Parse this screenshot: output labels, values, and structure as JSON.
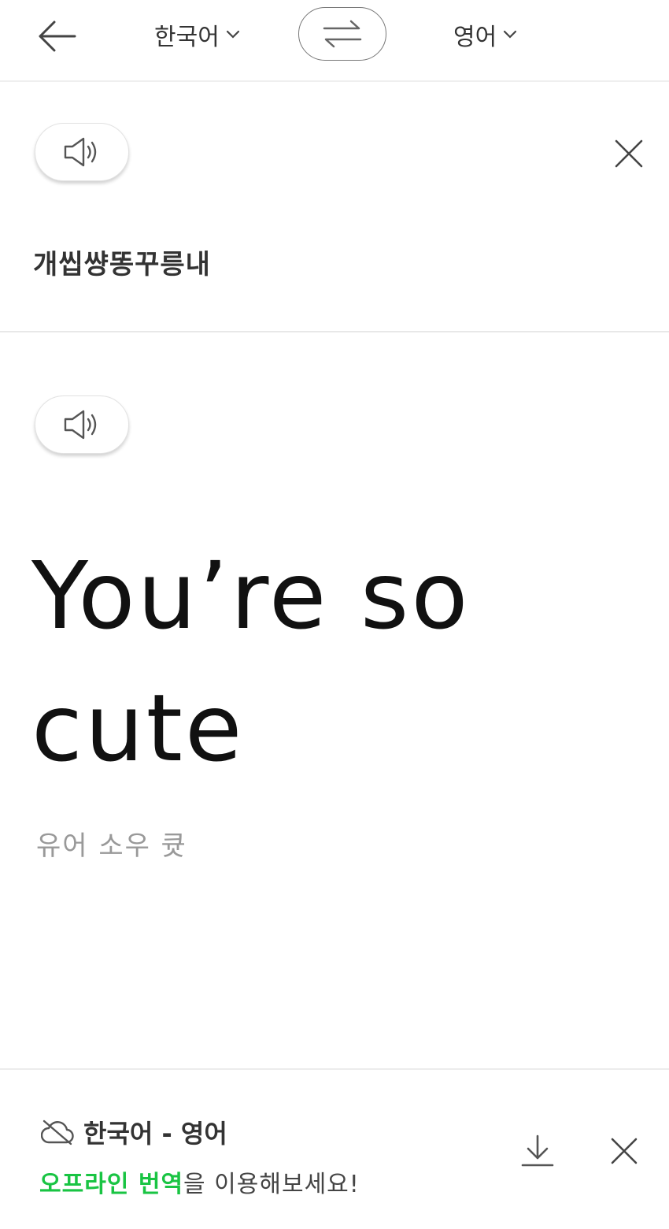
{
  "header": {
    "source_language": "한국어",
    "target_language": "영어"
  },
  "source": {
    "text": "개씹썅똥꾸릉내"
  },
  "result": {
    "translation": "You’re so cute",
    "pronunciation": "유어 소우 큣"
  },
  "offline_banner": {
    "title": "한국어 - 영어",
    "message_highlight": "오프라인 번역",
    "message_rest": "을 이용해보세요!"
  },
  "colors": {
    "accent_green": "#19c443",
    "text_dark": "#333333",
    "text_gray": "#999999"
  },
  "icons": [
    "back-arrow-icon",
    "chevron-down-icon",
    "swap-icon",
    "speaker-icon",
    "close-icon",
    "cloud-off-icon",
    "download-icon"
  ]
}
